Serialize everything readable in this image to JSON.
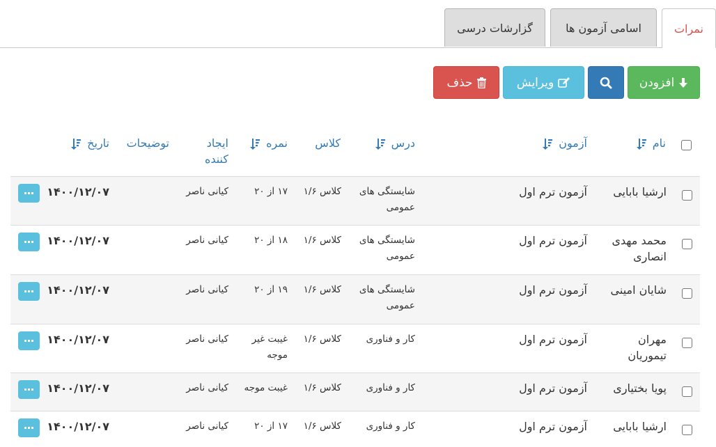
{
  "tabs": [
    {
      "label": "نمرات",
      "active": true
    },
    {
      "label": "اسامی آزمون ها",
      "active": false
    },
    {
      "label": "گزارشات درسی",
      "active": false
    }
  ],
  "toolbar": {
    "add_label": "افزودن",
    "edit_label": "ویرایش",
    "delete_label": "حذف"
  },
  "table": {
    "headers": {
      "name": "نام",
      "exam": "آزمون",
      "lesson": "درس",
      "class": "کلاس",
      "grade": "نمره",
      "creator_line1": "ایجاد",
      "creator_line2": "کننده",
      "description": "توضیحات",
      "date": "تاریخ"
    },
    "rows": [
      {
        "name1": "ارشیا بابایی",
        "name2": "",
        "exam": "آزمون ترم اول",
        "lesson1": "شایستگی های",
        "lesson2": "عمومی",
        "class": "کلاس ۱/۶",
        "grade1": "۱۷ از ۲۰",
        "grade2": "",
        "creator": "کیانی ناصر",
        "description": "",
        "date": "۱۴۰۰/۱۲/۰۷"
      },
      {
        "name1": "محمد مهدی",
        "name2": "انصاری",
        "exam": "آزمون ترم اول",
        "lesson1": "شایستگی های",
        "lesson2": "عمومی",
        "class": "کلاس ۱/۶",
        "grade1": "۱۸ از ۲۰",
        "grade2": "",
        "creator": "کیانی ناصر",
        "description": "",
        "date": "۱۴۰۰/۱۲/۰۷"
      },
      {
        "name1": "شایان امینی",
        "name2": "",
        "exam": "آزمون ترم اول",
        "lesson1": "شایستگی های",
        "lesson2": "عمومی",
        "class": "کلاس ۱/۶",
        "grade1": "۱۹ از ۲۰",
        "grade2": "",
        "creator": "کیانی ناصر",
        "description": "",
        "date": "۱۴۰۰/۱۲/۰۷"
      },
      {
        "name1": "مهران",
        "name2": "تیموریان",
        "exam": "آزمون ترم اول",
        "lesson1": "کار و فناوری",
        "lesson2": "",
        "class": "کلاس ۱/۶",
        "grade1": "غیبت غیر",
        "grade2": "موجه",
        "creator": "کیانی ناصر",
        "description": "",
        "date": "۱۴۰۰/۱۲/۰۷"
      },
      {
        "name1": "پویا بختیاری",
        "name2": "",
        "exam": "آزمون ترم اول",
        "lesson1": "کار و فناوری",
        "lesson2": "",
        "class": "کلاس ۱/۶",
        "grade1": "غیبت موجه",
        "grade2": "",
        "creator": "کیانی ناصر",
        "description": "",
        "date": "۱۴۰۰/۱۲/۰۷"
      },
      {
        "name1": "ارشیا بابایی",
        "name2": "",
        "exam": "آزمون ترم اول",
        "lesson1": "کار و فناوری",
        "lesson2": "",
        "class": "کلاس ۱/۶",
        "grade1": "۱۷ از ۲۰",
        "grade2": "",
        "creator": "کیانی ناصر",
        "description": "",
        "date": "۱۴۰۰/۱۲/۰۷"
      }
    ]
  },
  "colors": {
    "active_tab_text": "#d9534f",
    "header_link": "#337ab7",
    "add_button": "#5cb85c",
    "search_button": "#337ab7",
    "edit_button": "#5bc0de",
    "delete_button": "#d9534f"
  },
  "icons": {
    "add": "arrow-down-icon",
    "search": "search-icon",
    "edit": "edit-icon",
    "delete": "trash-icon",
    "sort": "sort-icon",
    "more": "ellipsis-icon"
  }
}
